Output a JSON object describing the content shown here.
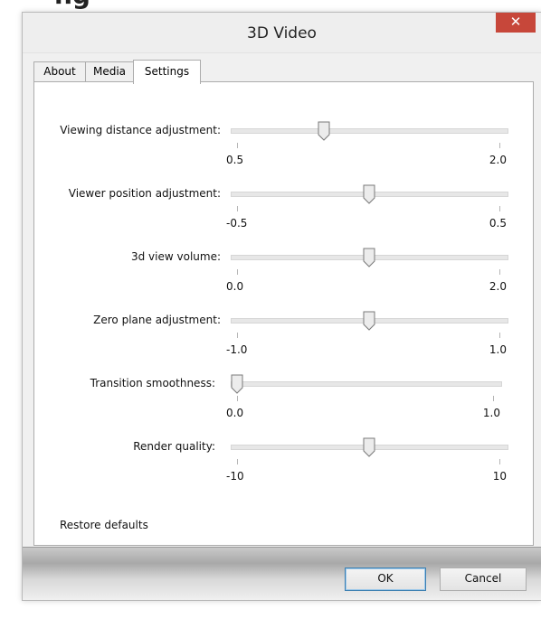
{
  "background": {
    "heading": "ng"
  },
  "window": {
    "title": "3D Video",
    "close_glyph": "✕",
    "tabs": [
      {
        "label": "About",
        "active": false
      },
      {
        "label": "Media",
        "active": false
      },
      {
        "label": "Settings",
        "active": true
      }
    ]
  },
  "settings": {
    "sliders": [
      {
        "label": "Viewing distance adjustment:",
        "min_label": "0.5",
        "max_label": "2.0",
        "position_fraction": 0.33
      },
      {
        "label": "Viewer position adjustment:",
        "min_label": "-0.5",
        "max_label": "0.5",
        "position_fraction": 0.5
      },
      {
        "label": "3d view volume:",
        "min_label": "0.0",
        "max_label": "2.0",
        "position_fraction": 0.5
      },
      {
        "label": "Zero plane adjustment:",
        "min_label": "-1.0",
        "max_label": "1.0",
        "position_fraction": 0.5
      },
      {
        "label": "Transition smoothness:",
        "min_label": "0.0",
        "max_label": "1.0",
        "position_fraction": 0.0
      },
      {
        "label": "Render quality:",
        "min_label": "-10",
        "max_label": "10",
        "position_fraction": 0.5
      }
    ],
    "restore_label": "Restore defaults"
  },
  "buttons": {
    "ok": "OK",
    "cancel": "Cancel"
  },
  "colors": {
    "close_button": "#c7473a",
    "default_button_border": "#3c7fb1"
  }
}
